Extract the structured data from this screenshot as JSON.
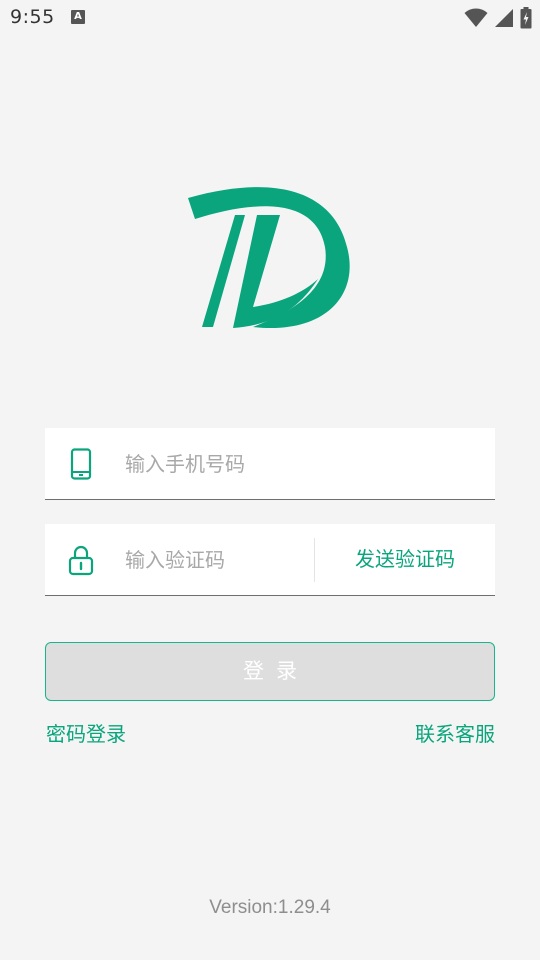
{
  "status_bar": {
    "time": "9:55",
    "notification_badge": "A"
  },
  "brand_color": "#0aa57d",
  "form": {
    "phone": {
      "icon": "smartphone-icon",
      "placeholder": "输入手机号码",
      "value": ""
    },
    "code": {
      "icon": "lock-icon",
      "placeholder": "输入验证码",
      "value": "",
      "send_label": "发送验证码"
    },
    "login_label": "登录"
  },
  "links": {
    "password_login": "密码登录",
    "contact_service": "联系客服"
  },
  "version": "Version:1.29.4"
}
